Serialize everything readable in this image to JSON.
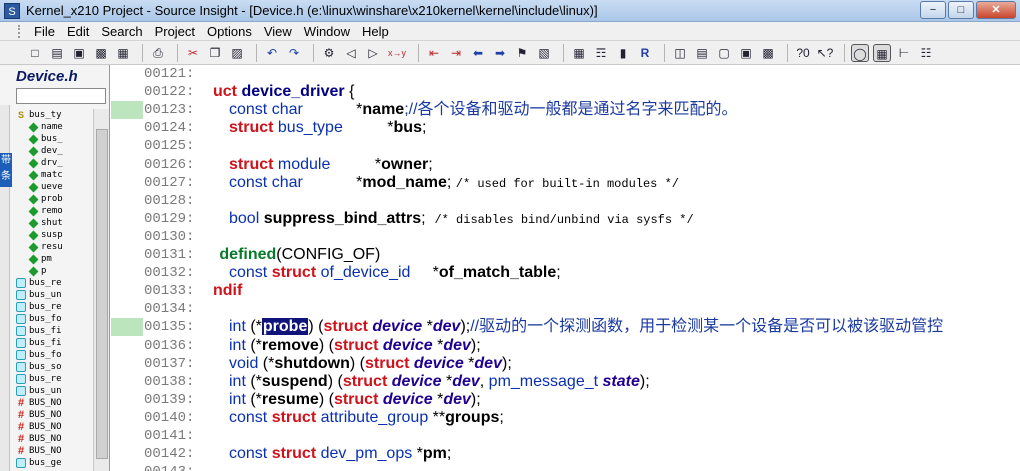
{
  "window": {
    "title": "Kernel_x210 Project - Source Insight - [Device.h (e:\\linux\\winshare\\x210kernel\\kernel\\include\\linux)]",
    "buttons": {
      "minimize": "−",
      "maximize": "□",
      "close": "✕"
    }
  },
  "menu": [
    "File",
    "Edit",
    "Search",
    "Project",
    "Options",
    "View",
    "Window",
    "Help"
  ],
  "toolbar": {
    "icons": [
      "new-file-icon",
      "open-folder-icon",
      "save-icon",
      "save-all-icon",
      "close-file-icon",
      "print-icon",
      "cut-icon",
      "copy-icon",
      "paste-icon",
      "undo-icon",
      "redo-icon",
      "find-icon",
      "find-prev-icon",
      "find-next-icon",
      "replace-icon",
      "jump-back-icon",
      "jump-forward-icon",
      "nav-back-icon",
      "nav-forward-icon",
      "bookmark-icon",
      "symbol-info-icon",
      "references-icon",
      "lookup-icon",
      "reference-icon",
      "window-layout-icon",
      "tile-icon",
      "cascade-icon",
      "symbol-window-icon",
      "help-mode-icon",
      "context-icon",
      "relation-icon",
      "browse-icon"
    ],
    "xy_label": "x→y"
  },
  "sidebar": {
    "title": "Device.h",
    "search_value": "",
    "badge": "带条",
    "items": [
      {
        "icon": "struct-header",
        "label": "bus_ty"
      },
      {
        "icon": "member",
        "label": "name"
      },
      {
        "icon": "member",
        "label": "bus_"
      },
      {
        "icon": "member",
        "label": "dev_"
      },
      {
        "icon": "member",
        "label": "drv_"
      },
      {
        "icon": "member",
        "label": "matc"
      },
      {
        "icon": "member",
        "label": "ueve"
      },
      {
        "icon": "member",
        "label": "prob"
      },
      {
        "icon": "member",
        "label": "remo"
      },
      {
        "icon": "member",
        "label": "shut"
      },
      {
        "icon": "member",
        "label": "susp"
      },
      {
        "icon": "member",
        "label": "resu"
      },
      {
        "icon": "member",
        "label": "pm"
      },
      {
        "icon": "member",
        "label": "p"
      },
      {
        "icon": "struct",
        "label": "bus_re"
      },
      {
        "icon": "struct",
        "label": "bus_un"
      },
      {
        "icon": "struct",
        "label": "bus_re"
      },
      {
        "icon": "struct",
        "label": "bus_fo"
      },
      {
        "icon": "struct",
        "label": "bus_fi"
      },
      {
        "icon": "struct",
        "label": "bus_fi"
      },
      {
        "icon": "struct",
        "label": "bus_fo"
      },
      {
        "icon": "struct",
        "label": "bus_so"
      },
      {
        "icon": "struct",
        "label": "bus_re"
      },
      {
        "icon": "struct",
        "label": "bus_un"
      },
      {
        "icon": "macro",
        "label": "BUS_NO"
      },
      {
        "icon": "macro",
        "label": "BUS_NO"
      },
      {
        "icon": "macro",
        "label": "BUS_NO"
      },
      {
        "icon": "macro",
        "label": "BUS_NO"
      },
      {
        "icon": "macro",
        "label": "BUS_NO"
      },
      {
        "icon": "struct",
        "label": "bus_ge"
      }
    ]
  },
  "code": {
    "lines": [
      {
        "num": "00121:",
        "marked": false,
        "parts": []
      },
      {
        "num": "00122:",
        "marked": false,
        "indent": 0,
        "parts": [
          {
            "c": "kw",
            "t": "uct "
          },
          {
            "c": "id",
            "t": "device_driver"
          },
          {
            "c": "",
            "t": " {"
          }
        ]
      },
      {
        "num": "00123:",
        "marked": true,
        "indent": 1,
        "parts": [
          {
            "c": "ty",
            "t": "const char"
          },
          {
            "c": "",
            "t": "            *"
          },
          {
            "c": "fld",
            "t": "name"
          },
          {
            "c": "cm",
            "t": ";//各个设备和驱动一般都是通过名字来匹配的。"
          }
        ]
      },
      {
        "num": "00124:",
        "marked": false,
        "indent": 1,
        "parts": [
          {
            "c": "kw",
            "t": "struct "
          },
          {
            "c": "ty",
            "t": "bus_type"
          },
          {
            "c": "",
            "t": "          *"
          },
          {
            "c": "fld",
            "t": "bus"
          },
          {
            "c": "",
            "t": ";"
          }
        ]
      },
      {
        "num": "00125:",
        "marked": false,
        "parts": []
      },
      {
        "num": "00126:",
        "marked": false,
        "indent": 1,
        "parts": [
          {
            "c": "kw",
            "t": "struct "
          },
          {
            "c": "ty",
            "t": "module"
          },
          {
            "c": "",
            "t": "          *"
          },
          {
            "c": "fld",
            "t": "owner"
          },
          {
            "c": "",
            "t": ";"
          }
        ]
      },
      {
        "num": "00127:",
        "marked": false,
        "indent": 1,
        "parts": [
          {
            "c": "ty",
            "t": "const char"
          },
          {
            "c": "",
            "t": "            *"
          },
          {
            "c": "fld",
            "t": "mod_name"
          },
          {
            "c": "",
            "t": "; "
          },
          {
            "c": "cmm",
            "t": "/* used for built-in modules */"
          }
        ]
      },
      {
        "num": "00128:",
        "marked": false,
        "parts": []
      },
      {
        "num": "00129:",
        "marked": false,
        "indent": 1,
        "parts": [
          {
            "c": "ty",
            "t": "bool "
          },
          {
            "c": "fld",
            "t": "suppress_bind_attrs"
          },
          {
            "c": "",
            "t": ";  "
          },
          {
            "c": "cmm",
            "t": "/* disables bind/unbind via sysfs */"
          }
        ]
      },
      {
        "num": "00130:",
        "marked": false,
        "parts": []
      },
      {
        "num": "00131:",
        "marked": false,
        "indent": 0.4,
        "parts": [
          {
            "c": "pp",
            "t": "defined"
          },
          {
            "c": "",
            "t": "(CONFIG_OF)"
          }
        ]
      },
      {
        "num": "00132:",
        "marked": false,
        "indent": 1,
        "parts": [
          {
            "c": "ty",
            "t": "const "
          },
          {
            "c": "kw",
            "t": "struct "
          },
          {
            "c": "ty",
            "t": "of_device_id"
          },
          {
            "c": "",
            "t": "     *"
          },
          {
            "c": "fld",
            "t": "of_match_table"
          },
          {
            "c": "",
            "t": ";"
          }
        ]
      },
      {
        "num": "00133:",
        "marked": false,
        "indent": 0,
        "parts": [
          {
            "c": "kw",
            "t": "ndif"
          }
        ]
      },
      {
        "num": "00134:",
        "marked": false,
        "parts": []
      },
      {
        "num": "00135:",
        "marked": true,
        "indent": 1,
        "parts": [
          {
            "c": "ty",
            "t": "int "
          },
          {
            "c": "",
            "t": "(*"
          },
          {
            "c": "sel",
            "t": "probe"
          },
          {
            "c": "",
            "t": ") ("
          },
          {
            "c": "kw",
            "t": "struct "
          },
          {
            "c": "par",
            "t": "device"
          },
          {
            "c": "",
            "t": " *"
          },
          {
            "c": "par",
            "t": "dev"
          },
          {
            "c": "",
            "t": ");"
          },
          {
            "c": "cm",
            "t": "//驱动的一个探测函数，用于检测某一个设备是否可以被该驱动管控"
          }
        ]
      },
      {
        "num": "00136:",
        "marked": false,
        "indent": 1,
        "parts": [
          {
            "c": "ty",
            "t": "int "
          },
          {
            "c": "",
            "t": "(*"
          },
          {
            "c": "fld",
            "t": "remove"
          },
          {
            "c": "",
            "t": ") ("
          },
          {
            "c": "kw",
            "t": "struct "
          },
          {
            "c": "par",
            "t": "device"
          },
          {
            "c": "",
            "t": " *"
          },
          {
            "c": "par",
            "t": "dev"
          },
          {
            "c": "",
            "t": ");"
          }
        ]
      },
      {
        "num": "00137:",
        "marked": false,
        "indent": 1,
        "parts": [
          {
            "c": "ty",
            "t": "void "
          },
          {
            "c": "",
            "t": "(*"
          },
          {
            "c": "fld",
            "t": "shutdown"
          },
          {
            "c": "",
            "t": ") ("
          },
          {
            "c": "kw",
            "t": "struct "
          },
          {
            "c": "par",
            "t": "device"
          },
          {
            "c": "",
            "t": " *"
          },
          {
            "c": "par",
            "t": "dev"
          },
          {
            "c": "",
            "t": ");"
          }
        ]
      },
      {
        "num": "00138:",
        "marked": false,
        "indent": 1,
        "parts": [
          {
            "c": "ty",
            "t": "int "
          },
          {
            "c": "",
            "t": "(*"
          },
          {
            "c": "fld",
            "t": "suspend"
          },
          {
            "c": "",
            "t": ") ("
          },
          {
            "c": "kw",
            "t": "struct "
          },
          {
            "c": "par",
            "t": "device"
          },
          {
            "c": "",
            "t": " *"
          },
          {
            "c": "par",
            "t": "dev"
          },
          {
            "c": "",
            "t": ", "
          },
          {
            "c": "ty",
            "t": "pm_message_t "
          },
          {
            "c": "par",
            "t": "state"
          },
          {
            "c": "",
            "t": ");"
          }
        ]
      },
      {
        "num": "00139:",
        "marked": false,
        "indent": 1,
        "parts": [
          {
            "c": "ty",
            "t": "int "
          },
          {
            "c": "",
            "t": "(*"
          },
          {
            "c": "fld",
            "t": "resume"
          },
          {
            "c": "",
            "t": ") ("
          },
          {
            "c": "kw",
            "t": "struct "
          },
          {
            "c": "par",
            "t": "device"
          },
          {
            "c": "",
            "t": " *"
          },
          {
            "c": "par",
            "t": "dev"
          },
          {
            "c": "",
            "t": ");"
          }
        ]
      },
      {
        "num": "00140:",
        "marked": false,
        "indent": 1,
        "parts": [
          {
            "c": "ty",
            "t": "const "
          },
          {
            "c": "kw",
            "t": "struct "
          },
          {
            "c": "ty",
            "t": "attribute_group"
          },
          {
            "c": "",
            "t": " **"
          },
          {
            "c": "fld",
            "t": "groups"
          },
          {
            "c": "",
            "t": ";"
          }
        ]
      },
      {
        "num": "00141:",
        "marked": false,
        "parts": []
      },
      {
        "num": "00142:",
        "marked": false,
        "indent": 1,
        "parts": [
          {
            "c": "ty",
            "t": "const "
          },
          {
            "c": "kw",
            "t": "struct "
          },
          {
            "c": "ty",
            "t": "dev_pm_ops"
          },
          {
            "c": "",
            "t": " *"
          },
          {
            "c": "fld",
            "t": "pm"
          },
          {
            "c": "",
            "t": ";"
          }
        ]
      },
      {
        "num": "00143:",
        "marked": false,
        "parts": []
      }
    ]
  },
  "colors": {
    "keyword": "#d0121b",
    "type": "#0a30b0",
    "identifier": "#000080",
    "comment": "#1a3aa0",
    "preprocessor": "#0a7a2a",
    "selection": "#10147a",
    "bookmark": "#bde5bd"
  }
}
